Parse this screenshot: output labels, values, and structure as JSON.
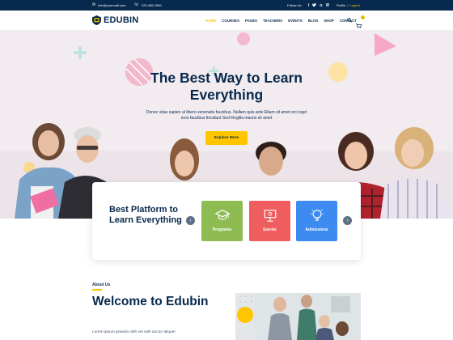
{
  "topbar": {
    "email": "info@yourmail.com",
    "phone": "123-456-7890",
    "follow_label": "Follow Us :",
    "social_icons": [
      "facebook-icon",
      "twitter-icon",
      "google-plus-icon",
      "instagram-icon"
    ],
    "profile_label": "Profile",
    "separator": "/",
    "logout_label": "Logout"
  },
  "header": {
    "brand": "EDUBIN",
    "nav": [
      "HOME",
      "COURSES",
      "PAGES",
      "TEACHERS",
      "EVENTS",
      "BLOG",
      "SHOP",
      "CONTACT"
    ],
    "active_nav": "HOME",
    "cart_count": "0"
  },
  "hero": {
    "title": "The Best Way to Learn Everything",
    "subtitle": "Donec vitae sapien ut libero venenatis faucibus. Nullam quis ante Etiam sit amet orci eget eros faucibus tincidunt Sed fringilla mauris sit amet",
    "cta": "Explore More"
  },
  "categories": {
    "title": "Best Platform to Learn Everything",
    "items": [
      {
        "label": "Programs",
        "icon": "graduation-cap-icon",
        "color": "#8ebc53"
      },
      {
        "label": "Events",
        "icon": "presentation-board-icon",
        "color": "#f05d5e"
      },
      {
        "label": "Admissions",
        "icon": "lightbulb-icon",
        "color": "#3d8af1"
      }
    ]
  },
  "about": {
    "label": "About Us",
    "title": "Welcome to Edubin",
    "text": "Lorem ipsum gravida nibh vel velit auctor aliquet"
  },
  "colors": {
    "navy": "#07294d",
    "accent": "#ffc600",
    "hero_bg": "#f3ecf0"
  }
}
